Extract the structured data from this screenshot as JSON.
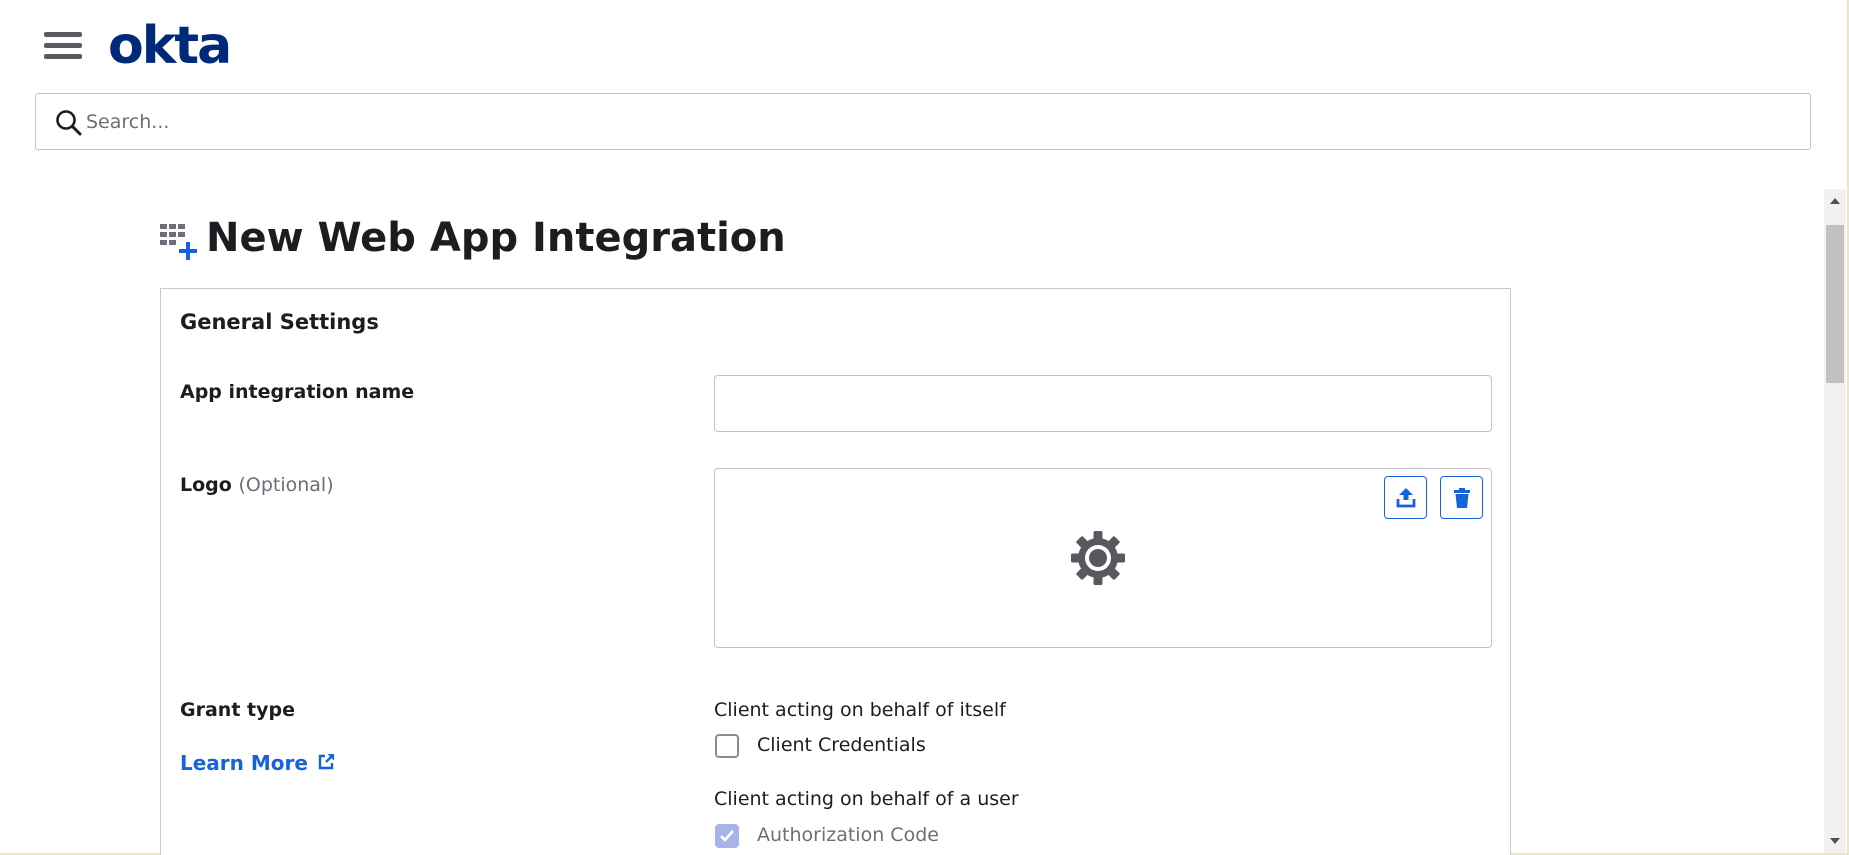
{
  "header": {
    "logo_text": "okta",
    "brand_color": "#00297a"
  },
  "search": {
    "placeholder": "Search..."
  },
  "page": {
    "title": "New Web App Integration"
  },
  "general_settings": {
    "title": "General Settings",
    "app_name_label": "App integration name",
    "app_name_value": "",
    "logo_label": "Logo",
    "logo_optional": "(Optional)",
    "grant_type_label": "Grant type",
    "learn_more": "Learn More",
    "group_itself_label": "Client acting on behalf of itself",
    "client_credentials_label": "Client Credentials",
    "client_credentials_checked": false,
    "group_user_label": "Client acting on behalf of a user",
    "authorization_code_label": "Authorization Code",
    "authorization_code_checked": true,
    "authorization_code_disabled": true
  },
  "colors": {
    "accent": "#1662dd",
    "text": "#1d1d21",
    "muted": "#6e6e78"
  },
  "icons": [
    "menu-icon",
    "search-icon",
    "app-grid-add-icon",
    "upload-icon",
    "trash-icon",
    "gear-icon",
    "external-link-icon",
    "checkmark-icon"
  ]
}
